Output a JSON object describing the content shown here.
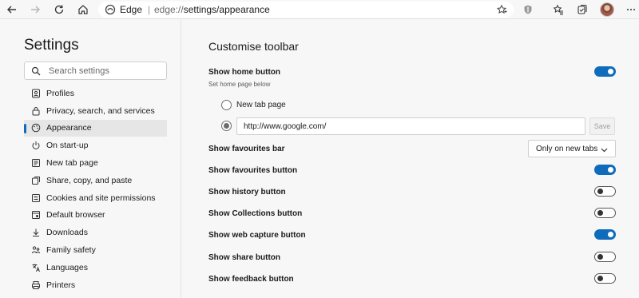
{
  "browser": {
    "brand": "Edge",
    "separator": "|",
    "url_scheme": "edge://",
    "url_path": "settings/appearance",
    "buttons": [
      "back",
      "forward",
      "refresh",
      "home",
      "favorite",
      "extension",
      "favorites",
      "collections",
      "profile",
      "more"
    ]
  },
  "sidebar": {
    "title": "Settings",
    "search_placeholder": "Search settings",
    "items": [
      {
        "label": "Profiles",
        "icon": "profile-icon"
      },
      {
        "label": "Privacy, search, and services",
        "icon": "lock-icon"
      },
      {
        "label": "Appearance",
        "icon": "palette-icon",
        "active": true
      },
      {
        "label": "On start-up",
        "icon": "power-icon"
      },
      {
        "label": "New tab page",
        "icon": "newtab-icon"
      },
      {
        "label": "Share, copy, and paste",
        "icon": "share-icon"
      },
      {
        "label": "Cookies and site permissions",
        "icon": "permissions-icon"
      },
      {
        "label": "Default browser",
        "icon": "browser-icon"
      },
      {
        "label": "Downloads",
        "icon": "download-icon"
      },
      {
        "label": "Family safety",
        "icon": "family-icon"
      },
      {
        "label": "Languages",
        "icon": "language-icon"
      },
      {
        "label": "Printers",
        "icon": "printer-icon"
      }
    ]
  },
  "main": {
    "section_title": "Customise toolbar",
    "home": {
      "label": "Show home button",
      "sub": "Set home page below",
      "enabled": true,
      "option_new_tab": "New tab page",
      "url_value": "http://www.google.com/",
      "save_label": "Save"
    },
    "favourites_bar": {
      "label": "Show favourites bar",
      "selected": "Only on new tabs"
    },
    "toggles": [
      {
        "label": "Show favourites button",
        "on": true
      },
      {
        "label": "Show history button",
        "on": false
      },
      {
        "label": "Show Collections button",
        "on": false
      },
      {
        "label": "Show web capture button",
        "on": true
      },
      {
        "label": "Show share button",
        "on": false
      },
      {
        "label": "Show feedback button",
        "on": false
      }
    ]
  },
  "colors": {
    "accent": "#0f6cbd",
    "background": "#f7f7f7"
  }
}
